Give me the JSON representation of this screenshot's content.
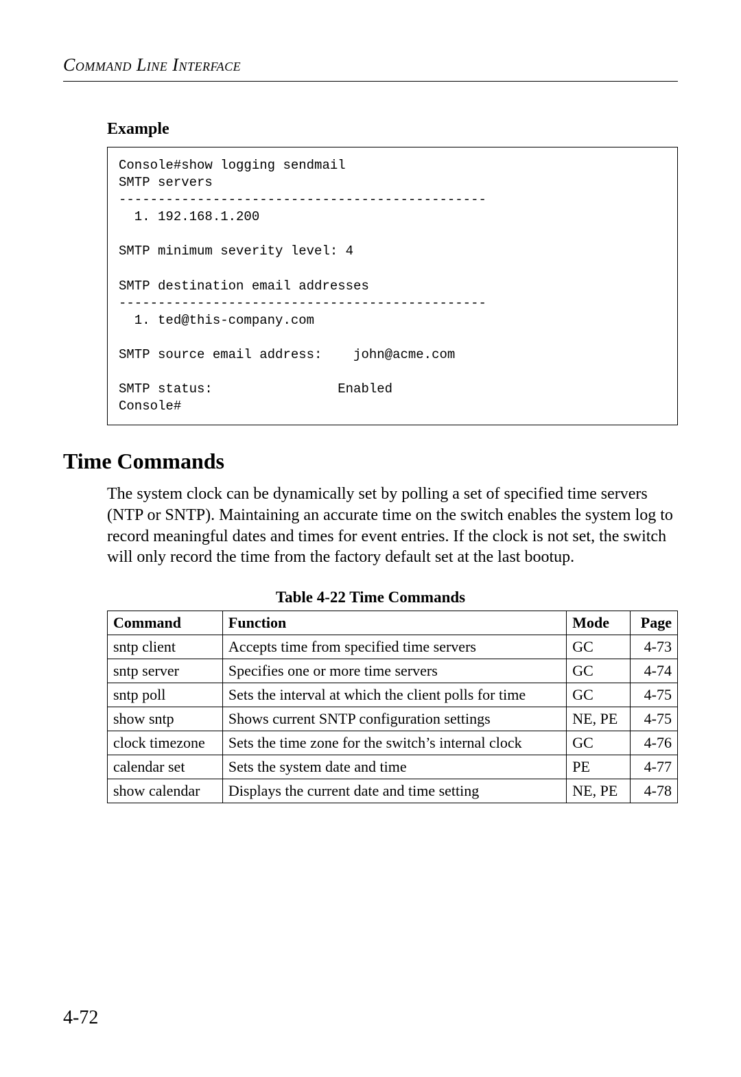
{
  "running_head": "Command Line Interface",
  "example_heading": "Example",
  "code_block": "Console#show logging sendmail\nSMTP servers\n-----------------------------------------------\n  1. 192.168.1.200\n\nSMTP minimum severity level: 4\n\nSMTP destination email addresses\n-----------------------------------------------\n  1. ted@this-company.com\n\nSMTP source email address:    john@acme.com\n\nSMTP status:                Enabled\nConsole#",
  "section_heading": "Time Commands",
  "body_para": "The system clock can be dynamically set by polling a set of specified time servers (NTP or SNTP). Maintaining an accurate time on the switch enables the system log to record meaningful dates and times for event entries. If the clock is not set, the switch will only record the time from the factory default set at the last bootup.",
  "table_caption": "Table 4-22  Time Commands",
  "table": {
    "headers": {
      "command": "Command",
      "function": "Function",
      "mode": "Mode",
      "page": "Page"
    },
    "rows": [
      {
        "command": "sntp client",
        "function": "Accepts time from specified time servers",
        "mode": "GC",
        "page": "4-73"
      },
      {
        "command": "sntp server",
        "function": "Specifies one or more time servers",
        "mode": "GC",
        "page": "4-74"
      },
      {
        "command": "sntp poll",
        "function": "Sets the interval at which the client polls for time",
        "mode": "GC",
        "page": "4-75"
      },
      {
        "command": "show sntp",
        "function": "Shows current SNTP configuration settings",
        "mode": "NE, PE",
        "page": "4-75"
      },
      {
        "command": "clock timezone",
        "function": "Sets the time zone for the switch’s internal clock",
        "mode": "GC",
        "page": "4-76"
      },
      {
        "command": "calendar set",
        "function": "Sets the system date and time",
        "mode": "PE",
        "page": "4-77"
      },
      {
        "command": "show calendar",
        "function": "Displays the current date and time setting",
        "mode": "NE, PE",
        "page": "4-78"
      }
    ]
  },
  "page_number": "4-72",
  "chart_data": {
    "type": "table",
    "title": "Table 4-22  Time Commands",
    "columns": [
      "Command",
      "Function",
      "Mode",
      "Page"
    ],
    "rows": [
      [
        "sntp client",
        "Accepts time from specified time servers",
        "GC",
        "4-73"
      ],
      [
        "sntp server",
        "Specifies one or more time servers",
        "GC",
        "4-74"
      ],
      [
        "sntp poll",
        "Sets the interval at which the client polls for time",
        "GC",
        "4-75"
      ],
      [
        "show sntp",
        "Shows current SNTP configuration settings",
        "NE, PE",
        "4-75"
      ],
      [
        "clock timezone",
        "Sets the time zone for the switch’s internal clock",
        "GC",
        "4-76"
      ],
      [
        "calendar set",
        "Sets the system date and time",
        "PE",
        "4-77"
      ],
      [
        "show calendar",
        "Displays the current date and time setting",
        "NE, PE",
        "4-78"
      ]
    ]
  }
}
